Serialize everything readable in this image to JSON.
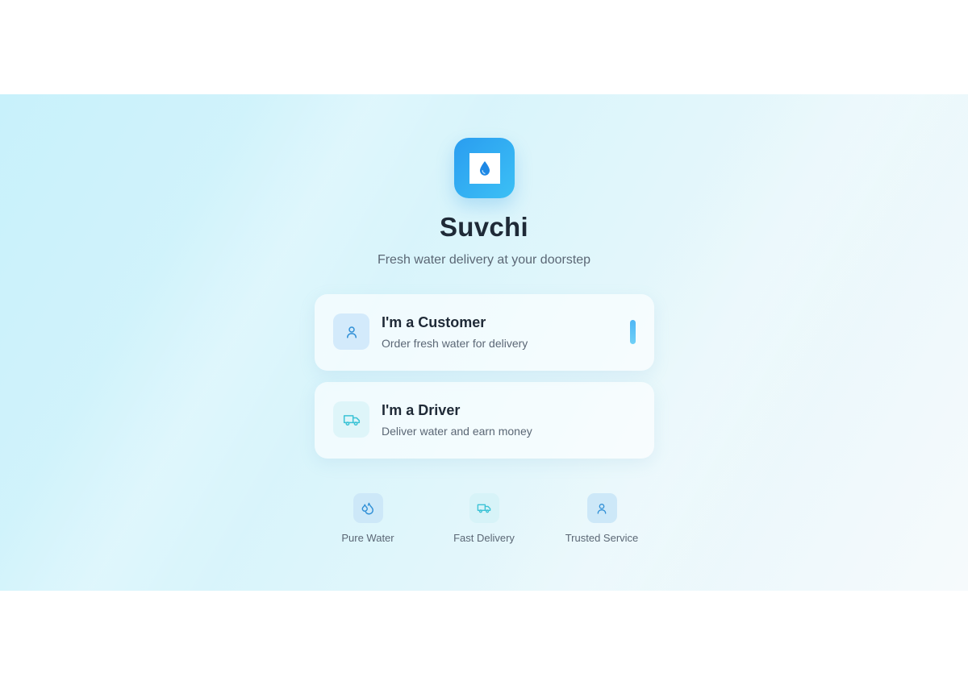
{
  "app": {
    "name": "Suvchi",
    "tagline": "Fresh water delivery at your doorstep",
    "logo_icon": "water-drop-icon"
  },
  "roles": [
    {
      "title": "I'm a Customer",
      "description": "Order fresh water for delivery",
      "icon": "user-icon",
      "selected": true
    },
    {
      "title": "I'm a Driver",
      "description": "Deliver water and earn money",
      "icon": "truck-icon",
      "selected": false
    }
  ],
  "features": [
    {
      "label": "Pure Water",
      "icon": "droplets-icon"
    },
    {
      "label": "Fast Delivery",
      "icon": "truck-icon"
    },
    {
      "label": "Trusted Service",
      "icon": "user-icon"
    }
  ],
  "colors": {
    "accent_blue": "#2a9df0",
    "accent_cyan": "#3cc0f5",
    "title_text": "#1f2a37",
    "muted_text": "#5b6775",
    "background_start": "#c8f1fb",
    "background_end": "#f6fafc"
  }
}
